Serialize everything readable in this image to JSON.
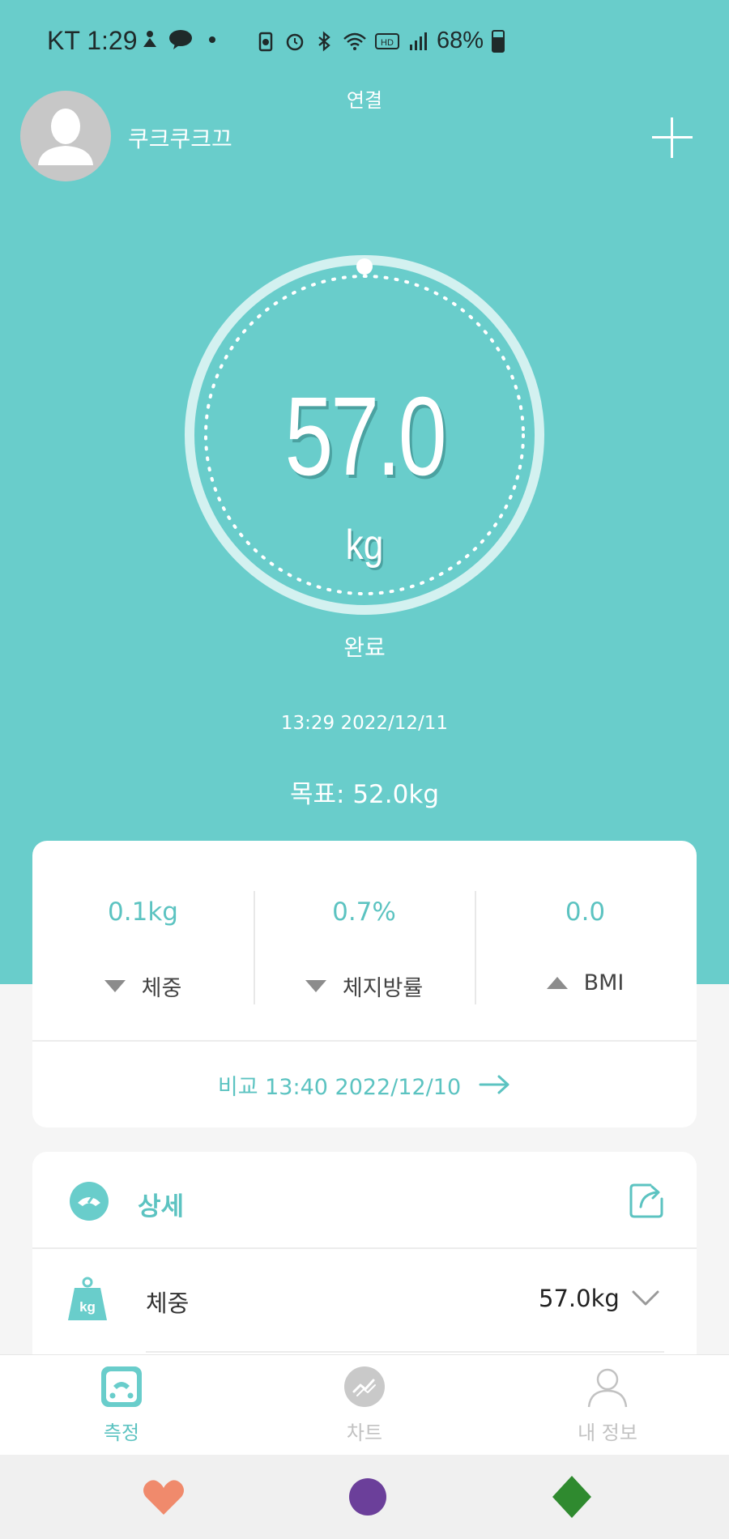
{
  "status_bar": {
    "carrier_time": "KT 1:29",
    "battery": "68%"
  },
  "header": {
    "username": "쿠크쿠크끄",
    "connect_label": "연결"
  },
  "measurement": {
    "weight": "57.0",
    "unit": "kg",
    "status": "완료",
    "time": "13:29 2022/12/11",
    "goal": "목표: 52.0kg"
  },
  "comparison": {
    "stats": [
      {
        "value": "0.1kg",
        "label": "체중",
        "direction": "down"
      },
      {
        "value": "0.7%",
        "label": "체지방률",
        "direction": "down"
      },
      {
        "value": "0.0",
        "label": "BMI",
        "direction": "up"
      }
    ],
    "link": "비교 13:40 2022/12/10"
  },
  "detail": {
    "title": "상세",
    "rows": [
      {
        "label": "체중",
        "value": "57.0kg"
      }
    ]
  },
  "bottom_nav": {
    "items": [
      {
        "label": "측정",
        "icon": "scale-icon",
        "active": true
      },
      {
        "label": "차트",
        "icon": "chart-icon",
        "active": false
      },
      {
        "label": "내 정보",
        "icon": "profile-icon",
        "active": false
      }
    ]
  },
  "colors": {
    "accent": "#69cdcb",
    "accent_text": "#5cc3c1",
    "ring": "#d3f1f0",
    "heart": "#f08a6c",
    "circle": "#6b3f9a",
    "diamond": "#2f8a2f"
  }
}
